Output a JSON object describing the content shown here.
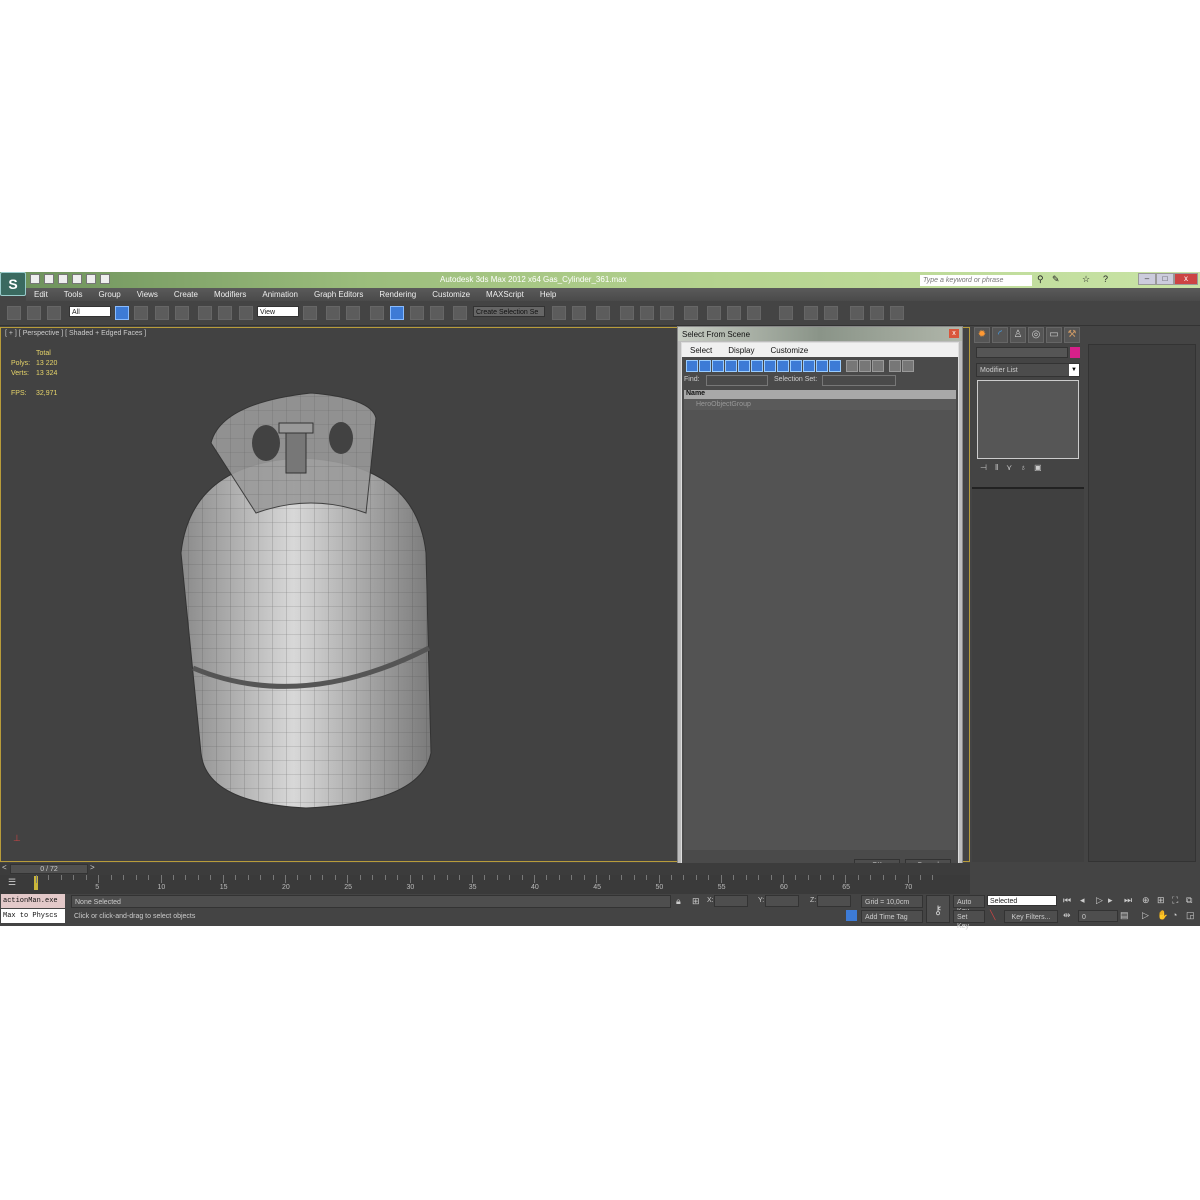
{
  "app": {
    "title": "Autodesk 3ds Max 2012 x64",
    "file": "Gas_Cylinder_361.max",
    "search_placeholder": "Type a keyword or phrase",
    "logo": "S"
  },
  "menu": [
    "Edit",
    "Tools",
    "Group",
    "Views",
    "Create",
    "Modifiers",
    "Animation",
    "Graph Editors",
    "Rendering",
    "Customize",
    "MAXScript",
    "Help"
  ],
  "toolbar": {
    "filter": "All",
    "coord": "View",
    "named_selection": "Create Selection Se"
  },
  "viewport": {
    "label": "[ + ] [ Perspective ] [ Shaded + Edged Faces ]",
    "stats": {
      "header": "Total",
      "polys_label": "Polys:",
      "polys": "13 220",
      "verts_label": "Verts:",
      "verts": "13 324",
      "fps_label": "FPS:",
      "fps": "32,971"
    }
  },
  "dialog": {
    "title": "Select From Scene",
    "menu": [
      "Select",
      "Display",
      "Customize"
    ],
    "find_label": "Find:",
    "selset_label": "Selection Set:",
    "col_name": "Name",
    "rows": [
      "HeroObjectGroup"
    ],
    "ok": "OK",
    "cancel": "Cancel"
  },
  "command_panel": {
    "modifier_list": "Modifier List",
    "swatch_color": "#d6208a"
  },
  "timeline": {
    "frame": "0 / 72",
    "current": 0,
    "total": 72,
    "ticks": [
      "5",
      "10",
      "15",
      "20",
      "25",
      "30",
      "35",
      "40",
      "45",
      "50",
      "55",
      "60",
      "65",
      "70"
    ]
  },
  "status": {
    "script1": "actionMan.exe",
    "script2": "Max to Physcs",
    "selection": "None Selected",
    "prompt": "Click or click-and-drag to select objects",
    "x_label": "X:",
    "y_label": "Y:",
    "z_label": "Z:",
    "grid": "Grid = 10,0cm",
    "add_time_tag": "Add Time Tag",
    "auto_key": "Auto Key",
    "set_key": "Set Key",
    "key_mode": "Selected",
    "key_filters": "Key Filters...",
    "frame_field": "0"
  }
}
